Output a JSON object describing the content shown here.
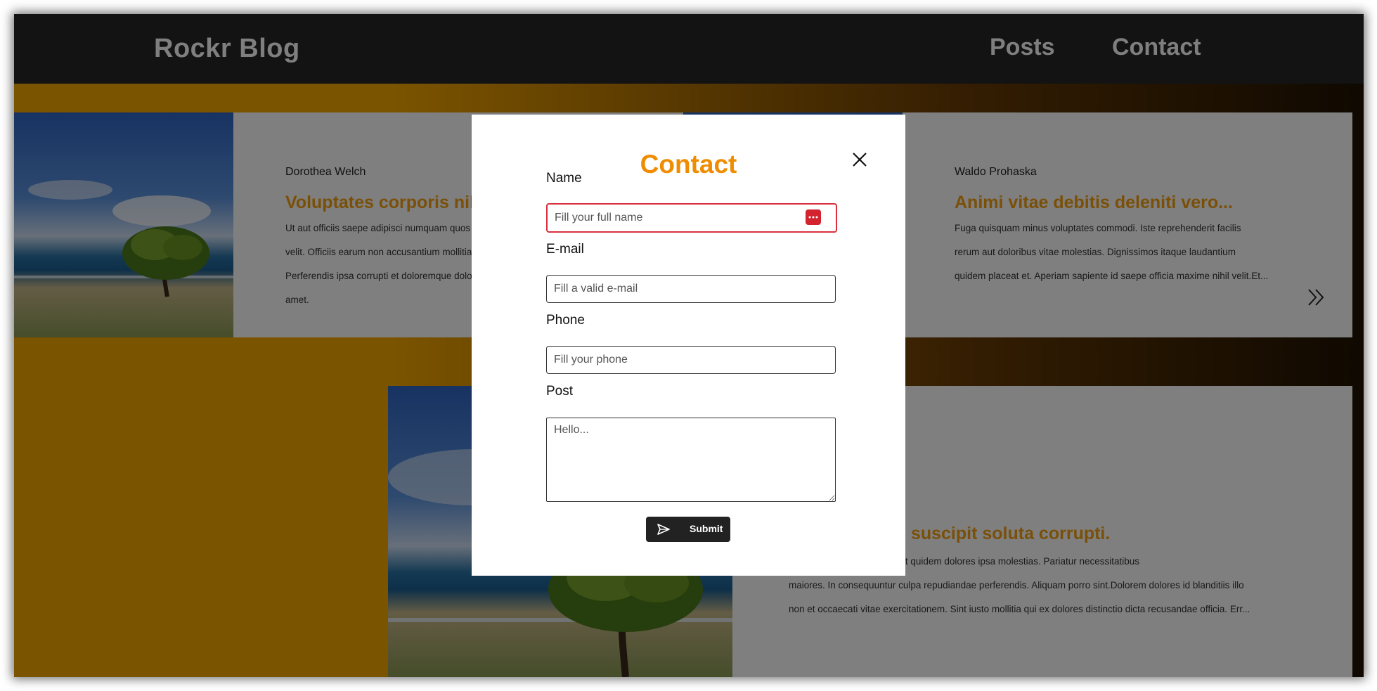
{
  "header": {
    "brand": "Rockr Blog",
    "nav": [
      "Posts",
      "Contact"
    ]
  },
  "posts": [
    {
      "author": "Dorothea Welch",
      "title": "Voluptates corporis nihil...",
      "excerpt": "Ut aut officiis saepe adipisci numquam quos et. Ipsam voluptatem laborum nam debitis velit. Officiis earum non accusantium mollitia ipsam tempore quas praesentium. Perferendis ipsa corrupti et doloremque dolor ad quis maxime assumenda impedit amet."
    },
    {
      "author": "Waldo Prohaska",
      "title": "Animi vitae debitis deleniti vero...",
      "excerpt_lines": [
        "Fuga quisquam minus voluptates commodi. Iste reprehenderit facilis",
        "rerum aut doloribus vitae molestias. Dignissimos itaque laudantium",
        "quidem placeat et. Aperiam sapiente id saepe officia maxime nihil velit.Et..."
      ]
    },
    {
      "title": "us maiores totam suscipit soluta corrupti.",
      "excerpt_lines": [
        "numquam. Sint quaerat fugit quidem dolores ipsa molestias. Pariatur necessitatibus",
        "maiores. In consequuntur culpa repudiandae perferendis. Aliquam porro sint.Dolorem dolores id blanditiis illo",
        "non et occaecati vitae exercitationem. Sint iusto mollitia qui ex dolores distinctio dicta recusandae officia. Err..."
      ]
    }
  ],
  "modal": {
    "title": "Contact",
    "fields": {
      "name": {
        "label": "Name",
        "placeholder": "Fill your full name",
        "value": ""
      },
      "email": {
        "label": "E-mail",
        "placeholder": "Fill a valid e-mail",
        "value": ""
      },
      "phone": {
        "label": "Phone",
        "placeholder": "Fill your phone",
        "value": ""
      },
      "post": {
        "label": "Post",
        "placeholder": "Hello...",
        "value": ""
      }
    },
    "submit_label": "Submit",
    "close_icon": "close-icon",
    "submit_icon": "send-icon",
    "password_manager_icon": "password-manager-icon"
  },
  "colors": {
    "accent": "#f08c00",
    "header_bg": "#262626",
    "active_field_border": "#d9303f"
  }
}
